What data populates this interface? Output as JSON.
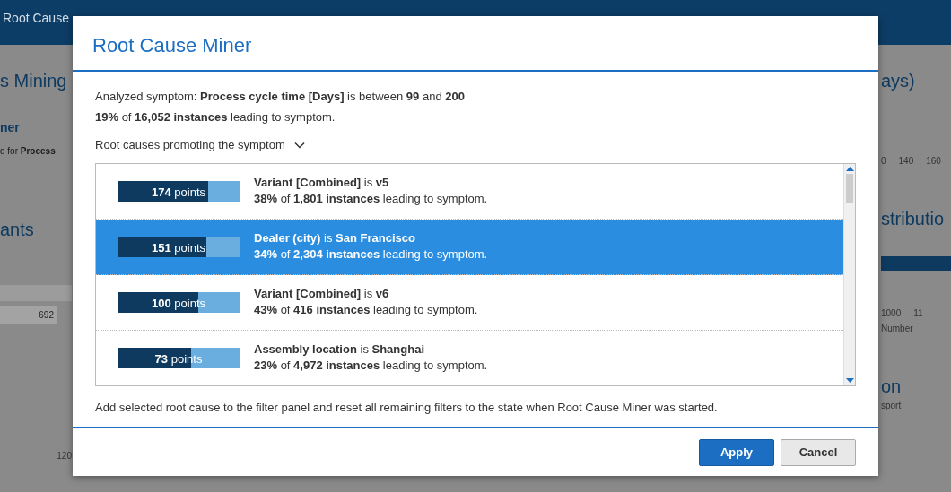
{
  "app_bar": {
    "title": "Root Cause"
  },
  "background": {
    "left": [
      {
        "kind": "heading",
        "text": "s Mining"
      },
      {
        "kind": "subheading",
        "text": "ner"
      },
      {
        "kind": "text",
        "text": "d for **Process**"
      },
      {
        "kind": "heading",
        "text": "ants"
      },
      {
        "kind": "bar_value",
        "text": "692"
      },
      {
        "kind": "axis",
        "text": "120"
      }
    ],
    "right": [
      {
        "kind": "heading",
        "text": "ays)"
      },
      {
        "kind": "ticks",
        "labels": [
          "0",
          "140",
          "160"
        ]
      },
      {
        "kind": "heading",
        "text": "stributio"
      },
      {
        "kind": "bar"
      },
      {
        "kind": "ticks",
        "labels": [
          "1000",
          "11"
        ]
      },
      {
        "kind": "axis",
        "text": "Number"
      },
      {
        "kind": "heading",
        "text": "on"
      },
      {
        "kind": "axis",
        "text": "sport"
      }
    ]
  },
  "dialog": {
    "title": "Root Cause Miner",
    "symptom": "Analyzed symptom: **Process cycle time [Days]** is between **99** and **200**",
    "share": "**19%** of **16,052 instances** leading to symptom.",
    "section": {
      "label": "Root causes promoting the symptom",
      "expanded": true
    },
    "causes": [
      {
        "score": "174",
        "unit": "points",
        "level": 0.74,
        "title": "**Variant [Combined]** is **v5**",
        "detail": "**38%** of **1,801 instances** leading to symptom.",
        "selected": false
      },
      {
        "score": "151",
        "unit": "points",
        "level": 0.73,
        "title": "**Dealer (city)** is **San Francisco**",
        "detail": "**34%** of **2,304 instances** leading to symptom.",
        "selected": true
      },
      {
        "score": "100",
        "unit": "points",
        "level": 0.66,
        "title": "**Variant [Combined]** is **v6**",
        "detail": "**43%** of **416 instances** leading to symptom.",
        "selected": false
      },
      {
        "score": "73",
        "unit": "points",
        "level": 0.6,
        "title": "**Assembly location** is **Shanghai**",
        "detail": "**23%** of **4,972 instances** leading to symptom.",
        "selected": false
      }
    ],
    "note": "Add selected root cause to the filter panel and reset all remaining filters to the state when Root Cause Miner was started.",
    "buttons": [
      {
        "label": "Apply",
        "kind": "primary"
      },
      {
        "label": "Cancel",
        "kind": "secondary"
      }
    ]
  }
}
